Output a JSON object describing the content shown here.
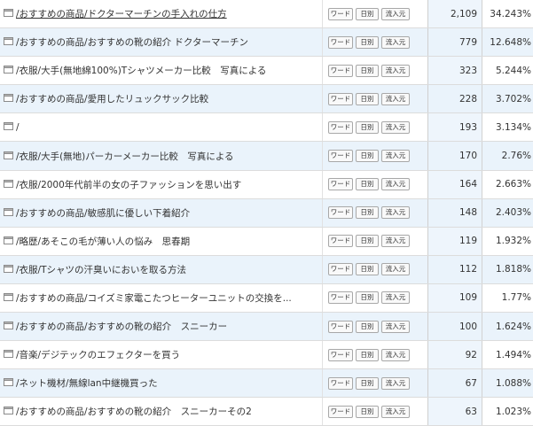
{
  "buttons": {
    "word": "ワード",
    "daily": "日別",
    "referrer": "流入元"
  },
  "rows": [
    {
      "page": "/おすすめの商品/ドクターマーチンの手入れの仕方",
      "count": "2,109",
      "percent": "34.243%",
      "underlined": true
    },
    {
      "page": "/おすすめの商品/おすすめの靴の紹介 ドクターマーチン",
      "count": "779",
      "percent": "12.648%"
    },
    {
      "page": "/衣服/大手(無地綿100%)Tシャツメーカー比較　写真による",
      "count": "323",
      "percent": "5.244%"
    },
    {
      "page": "/おすすめの商品/愛用したリュックサック比較",
      "count": "228",
      "percent": "3.702%"
    },
    {
      "page": "/",
      "count": "193",
      "percent": "3.134%"
    },
    {
      "page": "/衣服/大手(無地)パーカーメーカー比較　写真による",
      "count": "170",
      "percent": "2.76%"
    },
    {
      "page": "/衣服/2000年代前半の女の子ファッションを思い出す",
      "count": "164",
      "percent": "2.663%"
    },
    {
      "page": "/おすすめの商品/敏感肌に優しい下着紹介",
      "count": "148",
      "percent": "2.403%"
    },
    {
      "page": "/略歴/あそこの毛が薄い人の悩み　思春期",
      "count": "119",
      "percent": "1.932%"
    },
    {
      "page": "/衣服/Tシャツの汗臭いにおいを取る方法",
      "count": "112",
      "percent": "1.818%"
    },
    {
      "page": "/おすすめの商品/コイズミ家電こたつヒーターユニットの交換を...",
      "count": "109",
      "percent": "1.77%"
    },
    {
      "page": "/おすすめの商品/おすすめの靴の紹介　スニーカー",
      "count": "100",
      "percent": "1.624%"
    },
    {
      "page": "/音楽/デジテックのエフェクターを買う",
      "count": "92",
      "percent": "1.494%"
    },
    {
      "page": "/ネット機材/無線lan中継機買った",
      "count": "67",
      "percent": "1.088%"
    },
    {
      "page": "/おすすめの商品/おすすめの靴の紹介　スニーカーその2",
      "count": "63",
      "percent": "1.023%"
    }
  ]
}
